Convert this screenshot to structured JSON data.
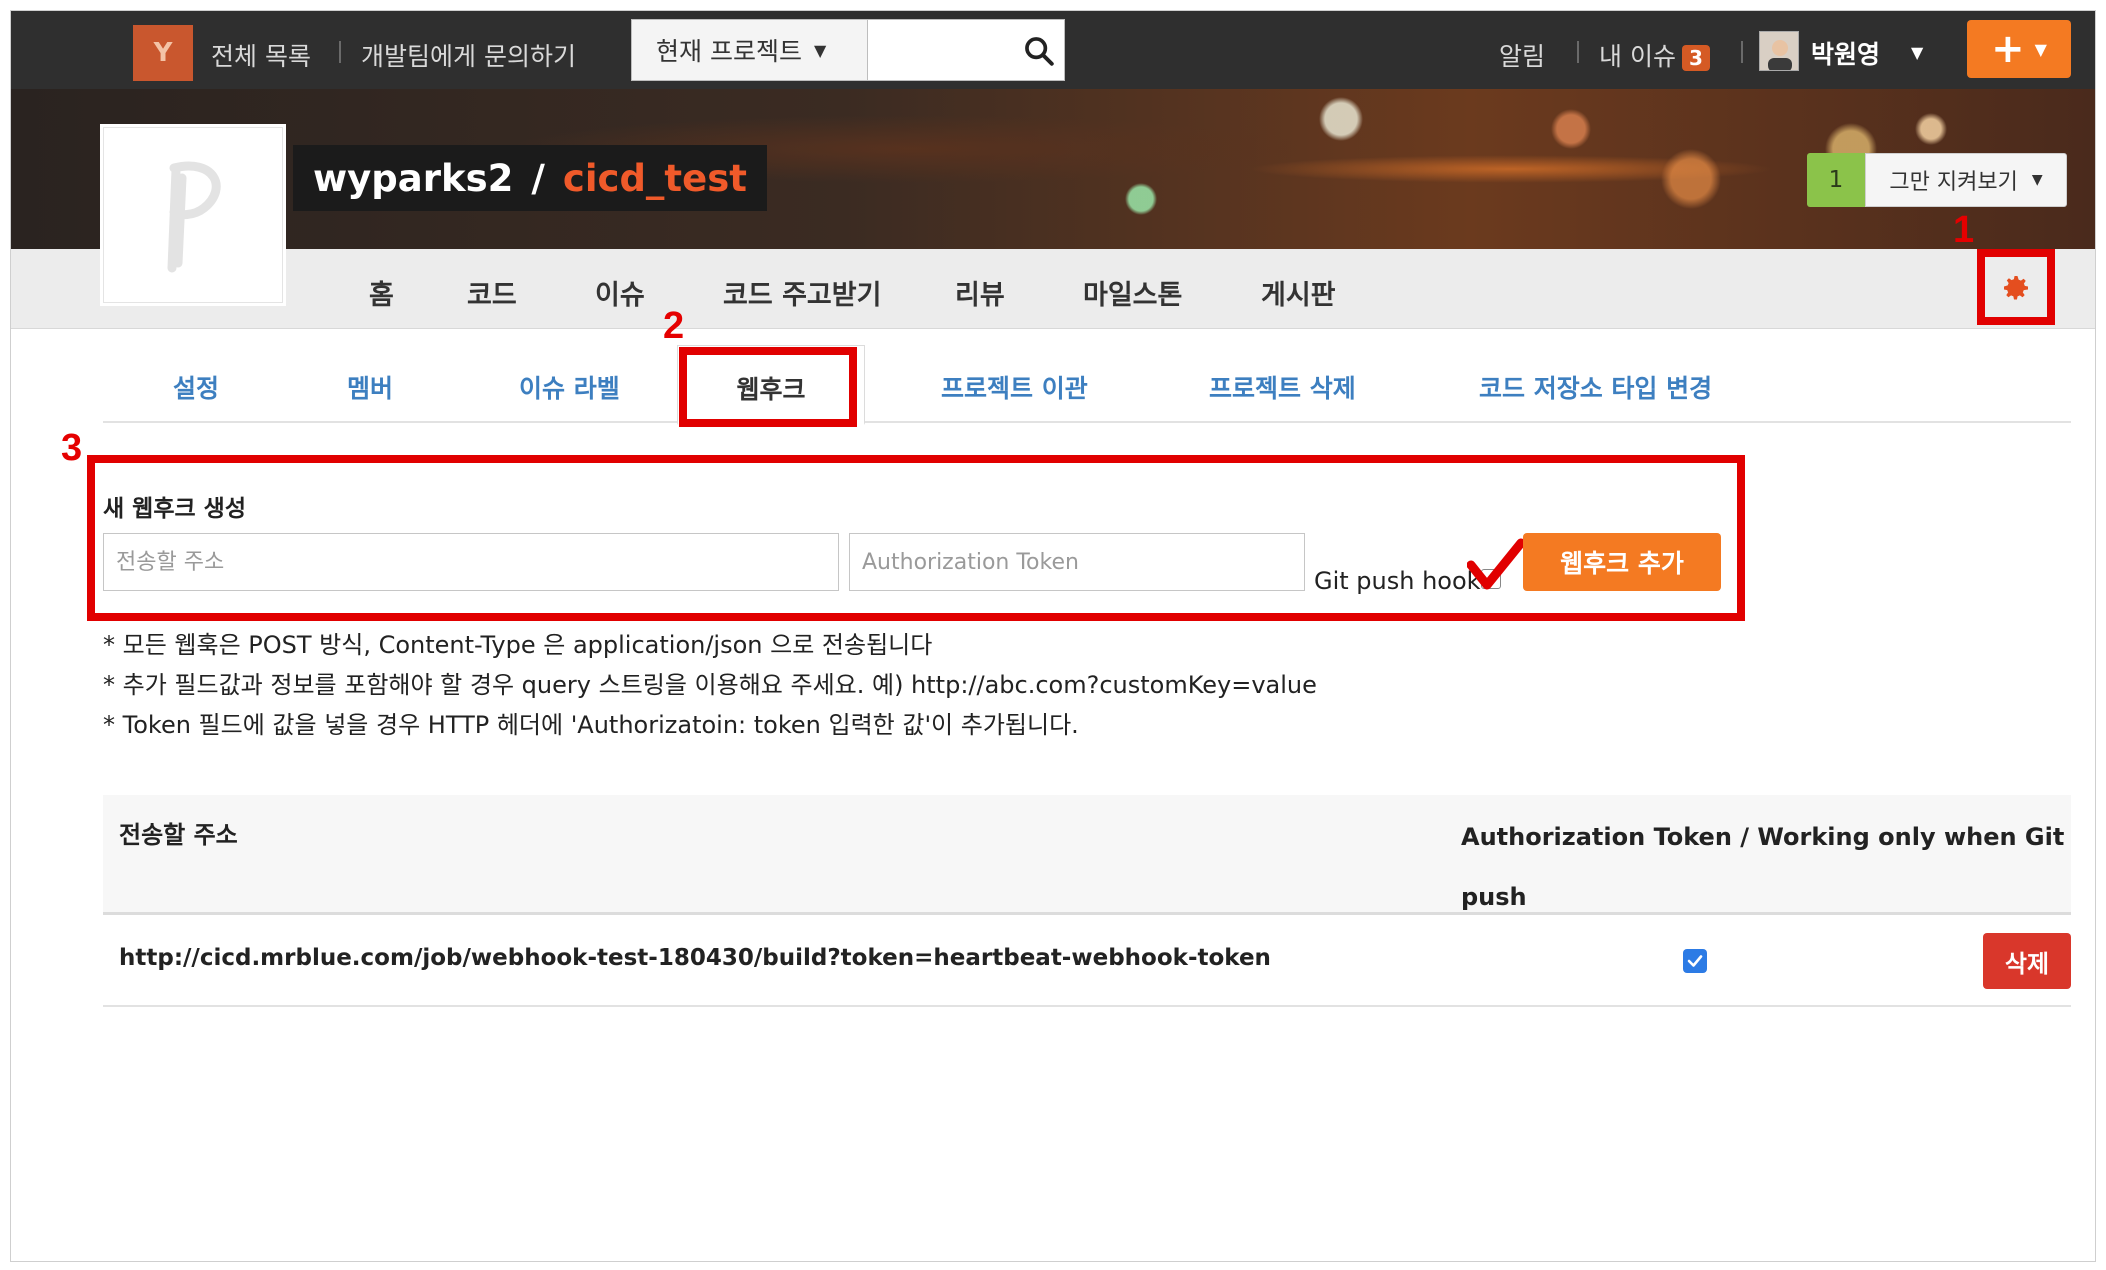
{
  "topbar": {
    "logo_letter": "Y",
    "all_list": "전체 목록",
    "contact_dev": "개발팀에게 문의하기",
    "project_select": "현재 프로젝트",
    "search_placeholder": "",
    "notifications": "알림",
    "my_issues": "내 이슈",
    "my_issues_count": "3",
    "username": "박원영",
    "icons": [
      "search-icon",
      "avatar",
      "plus-icon",
      "chevron-down-icon"
    ]
  },
  "project": {
    "owner": "wyparks2",
    "separator": "/",
    "name": "cicd_test",
    "watch_count": "1",
    "watch_label": "그만 지켜보기"
  },
  "nav": {
    "items": [
      "홈",
      "코드",
      "이슈",
      "코드 주고받기",
      "리뷰",
      "마일스톤",
      "게시판"
    ],
    "settings_icon": "gear-icon"
  },
  "subtabs": {
    "items": [
      "설정",
      "멤버",
      "이슈 라벨",
      "웹후크",
      "프로젝트 이관",
      "프로젝트 삭제",
      "코드 저장소 타입 변경"
    ],
    "active": "웹후크"
  },
  "annotations": {
    "one": "1",
    "two": "2",
    "three": "3"
  },
  "form": {
    "title": "새 웹후크 생성",
    "url_placeholder": "전송할 주소",
    "token_placeholder": "Authorization Token",
    "git_push_label": "Git push hook",
    "git_push_checked": false,
    "add_button": "웹후크 추가"
  },
  "notes": [
    "* 모든 웹훅은 POST 방식, Content-Type 은 application/json 으로 전송됩니다",
    "* 추가 필드값과 정보를 포함해야 할 경우 query 스트링을 이용해요 주세요. 예) http://abc.com?customKey=value",
    "* Token 필드에 값을 넣을 경우 HTTP 헤더에 'Authorizatoin: token 입력한 값'이 추가됩니다."
  ],
  "table": {
    "headers": [
      "전송할 주소",
      "Authorization Token / Working only when Git push"
    ],
    "rows": [
      {
        "url": "http://cicd.mrblue.com/job/webhook-test-180430/build?token=heartbeat-webhook-token",
        "git_push": true,
        "delete_label": "삭제"
      }
    ]
  },
  "colors": {
    "accent_orange": "#f47a22",
    "annotation_red": "#e10000",
    "delete_red": "#d9372b",
    "tab_blue": "#3d7fc0",
    "repo_name": "#f05a2a",
    "watch_green": "#8bc34a"
  }
}
